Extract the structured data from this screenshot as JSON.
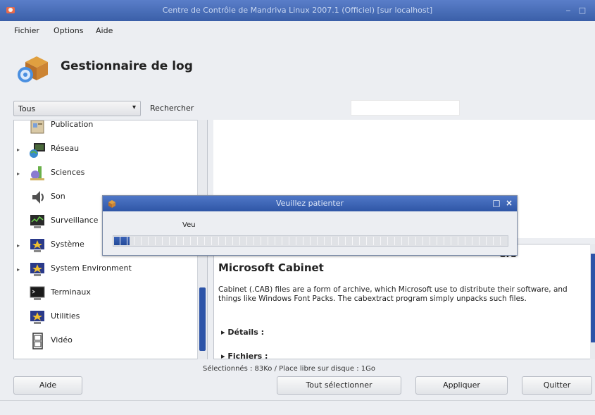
{
  "window": {
    "title": "Centre de Contrôle de Mandriva Linux 2007.1 (Officiel) [sur localhost]",
    "minimize_glyph": "‒",
    "maximize_glyph": "□"
  },
  "menubar": {
    "items": [
      "Fichier",
      "Options",
      "Aide"
    ]
  },
  "header": {
    "title": "Gestionnaire de log",
    "logo_icon": "package-manager-icon"
  },
  "filter": {
    "selected": "Tous",
    "arrow": "▾",
    "search_label": "Rechercher",
    "search_value": ""
  },
  "tree": {
    "items": [
      {
        "label": "Publication",
        "icon": "publishing-icon",
        "expandable": false
      },
      {
        "label": "Réseau",
        "icon": "network-icon",
        "expandable": true
      },
      {
        "label": "Sciences",
        "icon": "sciences-icon",
        "expandable": true
      },
      {
        "label": "Son",
        "icon": "sound-icon",
        "expandable": false
      },
      {
        "label": "Surveillance",
        "icon": "monitoring-icon",
        "expandable": false
      },
      {
        "label": "Système",
        "icon": "system-icon",
        "expandable": true
      },
      {
        "label": "System Environment",
        "icon": "system-environment-icon",
        "expandable": true
      },
      {
        "label": "Terminaux",
        "icon": "terminal-icon",
        "expandable": false
      },
      {
        "label": "Utilities",
        "icon": "utilities-icon",
        "expandable": false
      },
      {
        "label": "Vidéo",
        "icon": "video-icon",
        "expandable": false
      }
    ],
    "expander_glyph": "▸"
  },
  "description": {
    "partial_heading": "ers",
    "package_title": "Microsoft Cabinet",
    "package_description": "Cabinet (.CAB) files are a form of archive, which Microsoft use to distribute their software, and things like Windows Font Packs. The cabextract program simply unpacks such files.",
    "details_label": "Détails :",
    "files_label": "Fichiers :",
    "section_glyph": "▸"
  },
  "status": {
    "text": "Sélectionnés : 83Ko / Place libre sur disque : 1Go"
  },
  "buttons": {
    "help": "Aide",
    "select_all": "Tout sélectionner",
    "apply": "Appliquer",
    "quit": "Quitter"
  },
  "dialog": {
    "title": "Veuillez patienter",
    "message": "Veu",
    "maximize_glyph": "□",
    "close_glyph": "×",
    "progress_fraction": 0.04
  },
  "colors": {
    "accent": "#2d54a8",
    "titlebar": "#3a5fa8"
  }
}
